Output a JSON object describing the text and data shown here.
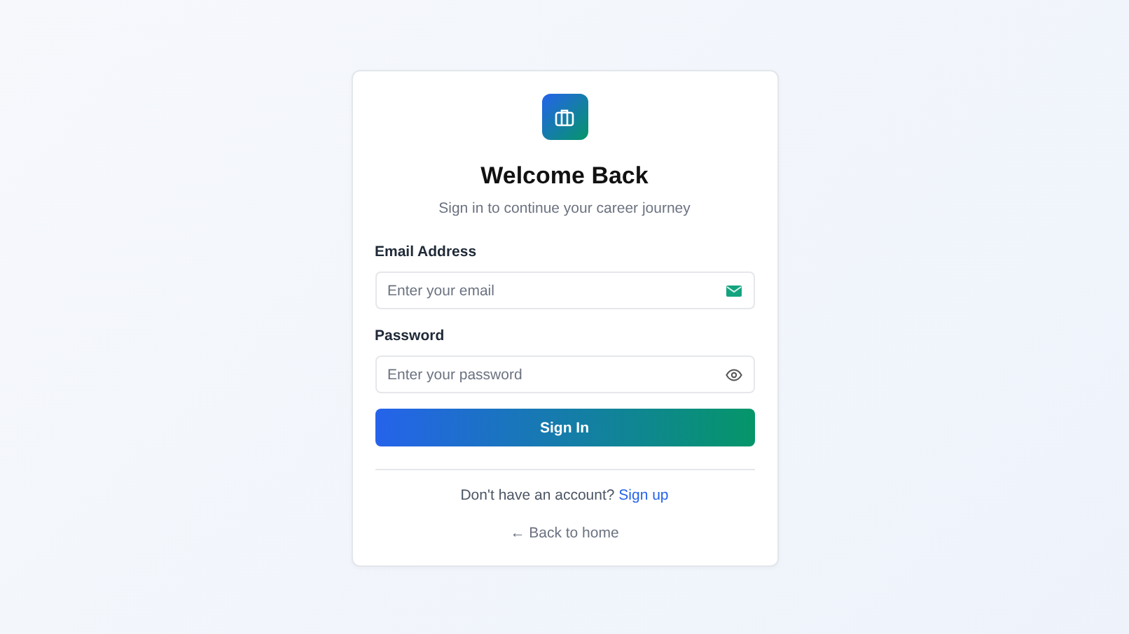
{
  "title": "Welcome Back",
  "subtitle": "Sign in to continue your career journey",
  "fields": [
    {
      "label": "Email Address",
      "placeholder": "Enter your email",
      "kind": "email"
    },
    {
      "label": "Password",
      "placeholder": "Enter your password",
      "kind": "password"
    }
  ],
  "submit": "Sign In",
  "signup": {
    "prompt": "Don't have an account?",
    "link": "Sign up"
  },
  "back": "← Back to home"
}
